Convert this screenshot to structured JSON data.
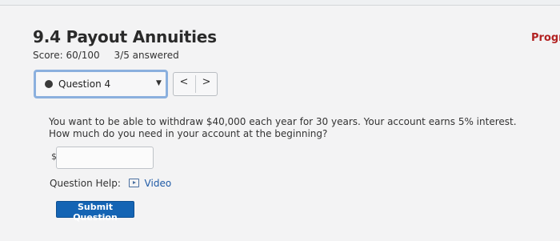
{
  "header": {
    "title": "9.4 Payout Annuities",
    "progress_label": "Progre",
    "score": "Score: 60/100",
    "answered": "3/5 answered"
  },
  "question_nav": {
    "selected": "Question 4",
    "prev_glyph": "<",
    "next_glyph": ">"
  },
  "question": {
    "text": "You want to be able to withdraw $40,000 each year for 30 years. Your account earns 5% interest. How much do you need in your account at the beginning?",
    "currency_symbol": "$",
    "answer_value": ""
  },
  "help": {
    "label": "Question Help:",
    "video_label": "Video",
    "video_icon": "video-icon"
  },
  "actions": {
    "submit_label": "Submit Question"
  },
  "colors": {
    "accent_button": "#1464b4",
    "progress_text": "#b22222",
    "selected_border": "#8bb0de"
  }
}
